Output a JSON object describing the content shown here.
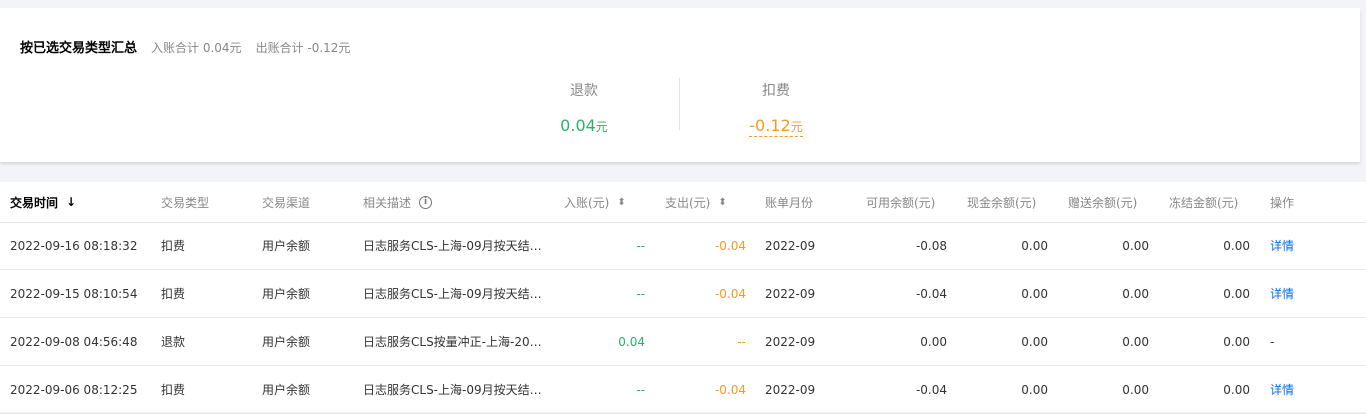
{
  "summary": {
    "title": "按已选交易类型汇总",
    "income_total": "入账合计 0.04元",
    "expense_total": "出账合计 -0.12元",
    "stats": [
      {
        "label": "退款",
        "value": "0.04",
        "unit": "元"
      },
      {
        "label": "扣费",
        "value": "-0.12",
        "unit": "元"
      }
    ]
  },
  "table": {
    "columns": {
      "time": "交易时间",
      "type": "交易类型",
      "channel": "交易渠道",
      "desc": "相关描述",
      "income": "入账(元)",
      "expense": "支出(元)",
      "month": "账单月份",
      "available": "可用余额(元)",
      "cash": "现金余额(元)",
      "gift": "赠送余额(元)",
      "frozen": "冻结金额(元)",
      "action": "操作"
    },
    "rows": [
      {
        "time": "2022-09-16 08:18:32",
        "type": "扣费",
        "channel": "用户余额",
        "desc": "日志服务CLS-上海-09月按天结…",
        "income": "--",
        "expense": "-0.04",
        "month": "2022-09",
        "available": "-0.08",
        "cash": "0.00",
        "gift": "0.00",
        "frozen": "0.00",
        "action": "详情"
      },
      {
        "time": "2022-09-15 08:10:54",
        "type": "扣费",
        "channel": "用户余额",
        "desc": "日志服务CLS-上海-09月按天结…",
        "income": "--",
        "expense": "-0.04",
        "month": "2022-09",
        "available": "-0.04",
        "cash": "0.00",
        "gift": "0.00",
        "frozen": "0.00",
        "action": "详情"
      },
      {
        "time": "2022-09-08 04:56:48",
        "type": "退款",
        "channel": "用户余额",
        "desc": "日志服务CLS按量冲正-上海-20…",
        "income": "0.04",
        "expense": "--",
        "month": "2022-09",
        "available": "0.00",
        "cash": "0.00",
        "gift": "0.00",
        "frozen": "0.00",
        "action": "-"
      },
      {
        "time": "2022-09-06 08:12:25",
        "type": "扣费",
        "channel": "用户余额",
        "desc": "日志服务CLS-上海-09月按天结…",
        "income": "--",
        "expense": "-0.04",
        "month": "2022-09",
        "available": "-0.04",
        "cash": "0.00",
        "gift": "0.00",
        "frozen": "0.00",
        "action": "详情"
      }
    ]
  }
}
